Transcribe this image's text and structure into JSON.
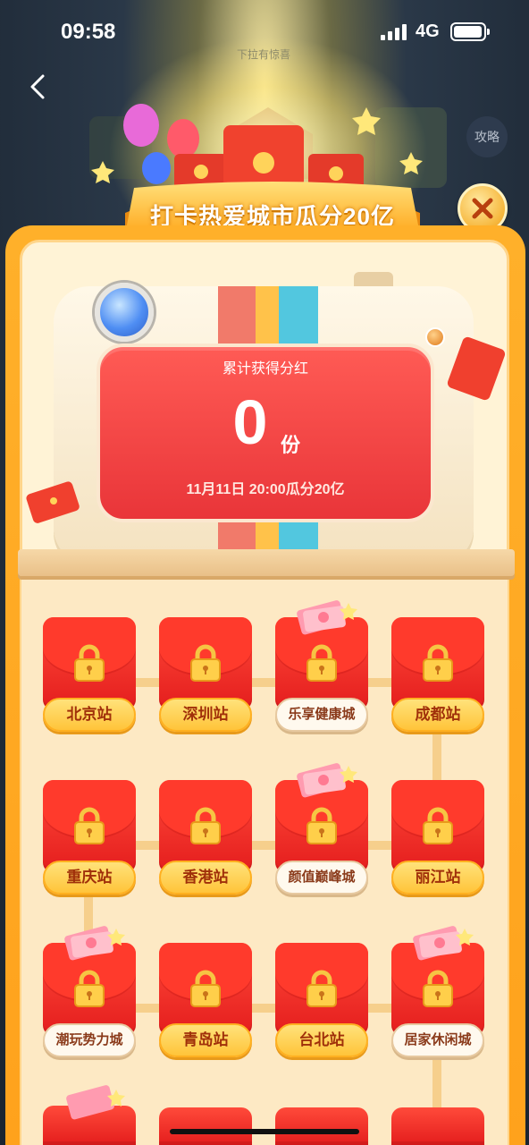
{
  "status_bar": {
    "time": "09:58",
    "network": "4G"
  },
  "pull_hint": "下拉有惊喜",
  "side_buttons": [
    "攻略"
  ],
  "banner": {
    "title": "打卡热爱城市瓜分20亿"
  },
  "summary": {
    "title": "累计获得分红",
    "count": "0",
    "unit": "份",
    "date": "11月11日 20:00瓜分20亿"
  },
  "cities": [
    {
      "label": "北京站",
      "special": false,
      "locked": true
    },
    {
      "label": "深圳站",
      "special": false,
      "locked": true
    },
    {
      "label": "乐享健康城",
      "special": true,
      "locked": true
    },
    {
      "label": "成都站",
      "special": false,
      "locked": true
    },
    {
      "label": "重庆站",
      "special": false,
      "locked": true
    },
    {
      "label": "香港站",
      "special": false,
      "locked": true
    },
    {
      "label": "颜值巅峰城",
      "special": true,
      "locked": true
    },
    {
      "label": "丽江站",
      "special": false,
      "locked": true
    },
    {
      "label": "潮玩势力城",
      "special": true,
      "locked": true
    },
    {
      "label": "青岛站",
      "special": false,
      "locked": true
    },
    {
      "label": "台北站",
      "special": false,
      "locked": true
    },
    {
      "label": "居家休闲城",
      "special": true,
      "locked": true
    }
  ],
  "colors": {
    "accent": "#ffb02a",
    "card": "#ff3a2c",
    "label": "#ffc43a"
  }
}
